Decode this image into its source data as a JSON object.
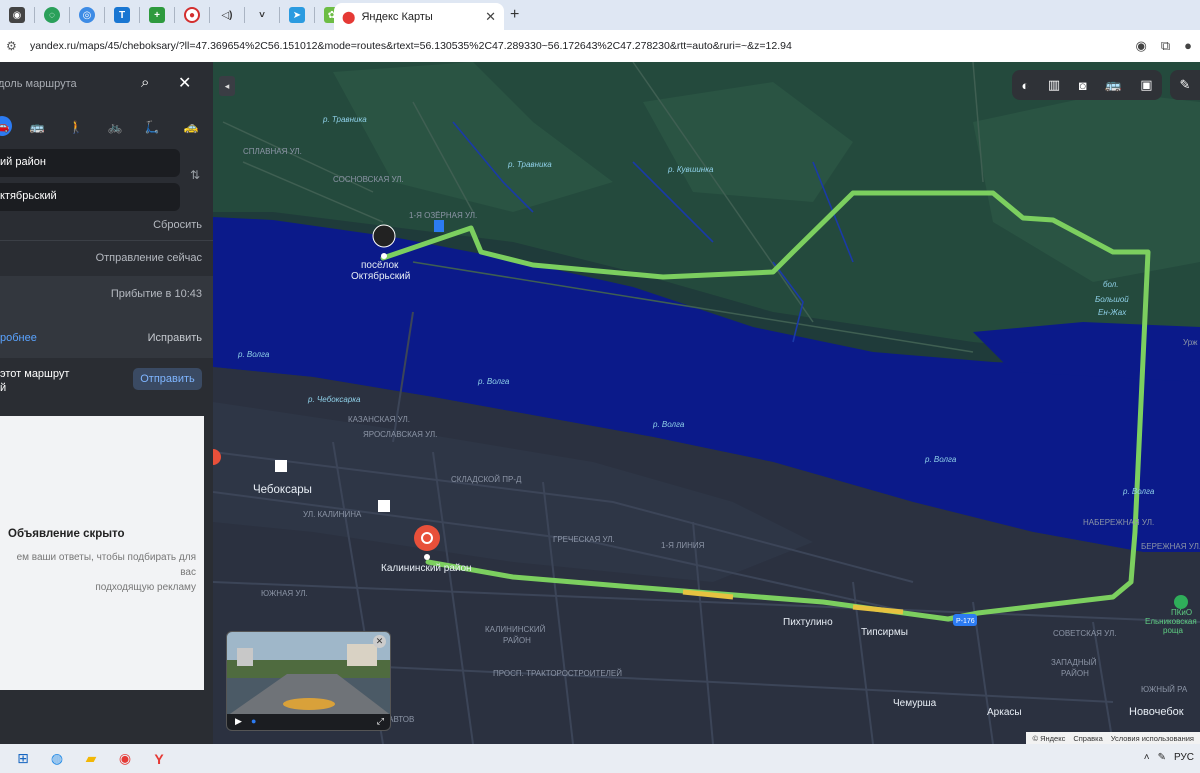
{
  "browser": {
    "tab_title": "Яндекс Карты",
    "url": "yandex.ru/maps/45/cheboksary/?ll=47.369654%2C56.151012&mode=routes&rtext=56.130535%2C47.289330~56.172643%2C47.278230&rtt=auto&ruri=~&z=12.94",
    "new_tab": "+",
    "close_tab": "✕"
  },
  "panel": {
    "search_placeholder": "доль маршрута",
    "from": "ий район",
    "to": "ктябрьский",
    "reset": "Сбросить",
    "departure": "Отправление сейчас",
    "arrival": "Прибытие в 10:43",
    "details": "робнее",
    "fix": "Исправить",
    "share_line1": "этот маршрут",
    "share_line2": "й",
    "send": "Отправить",
    "ad_title": "Объявление скрыто",
    "ad_sub1": "ем ваши ответы, чтобы подбирать для вас",
    "ad_sub2": "подходящую рекламу"
  },
  "map": {
    "labels": {
      "poselok1": "посёлок",
      "poselok2": "Октябрьский",
      "cheboksary": "Чебоксары",
      "kalininsky": "Калининский район",
      "volga1": "р. Волга",
      "volga2": "р. Волга",
      "volga3": "р. Волга",
      "volga4": "р. Волга",
      "volga5": "р. Волга",
      "travnika1": "р. Травника",
      "travnika2": "р. Травника",
      "cheboksarka": "р. Чебоксарка",
      "kuvshinka": "р. Кувшинка",
      "bol1": "бол.",
      "bol2": "Большой",
      "bol3": "Ен-Жах",
      "pikhtulino": "Пихтулино",
      "tipsirmy": "Типсирмы",
      "chemursha": "Чемурша",
      "arkasy": "Аркасы",
      "novocheb": "Новочебок",
      "kal_district1": "КАЛИНИНСКИЙ",
      "kal_district2": "РАЙОН",
      "zapadny1": "ЗАПАДНЫЙ",
      "zapadny2": "РАЙОН",
      "yuzhny": "ЮЖНЫЙ РА",
      "park1": "ПКиО",
      "park2": "Ельниковская",
      "park3": "роща",
      "urzh": "Урж",
      "r176": "Р-176",
      "street_sovetskaya": "СОВЕТСКАЯ УЛ.",
      "street_kazanskaya": "КАЗАНСКАЯ УЛ.",
      "street_yaroslavskaya": "ЯРОСЛАВСКАЯ УЛ.",
      "street_1ya_liniya": "1-Я ЛИНИЯ",
      "street_ozernaya": "1-Я ОЗЁРНАЯ УЛ.",
      "street_splavnaya": "СПЛАВНАЯ УЛ.",
      "street_sosnovskaya": "СОСНОВСКАЯ УЛ.",
      "street_naberezhnaya": "НАБЕРЕЖНАЯ УЛ.",
      "street_traktor": "ПРОСП. ТРАКТОРОСТРОИТЕЛЕЙ",
      "street_kalinina": "УЛ. КАЛИНИНА",
      "street_yuzhnaya": "ЮЖНАЯ УЛ.",
      "street_berezhnaya": "БЕРЕЖНАЯ УЛ.",
      "street_grecheskaya": "ГРЕЧЕСКАЯ УЛ.",
      "street_skladskaya": "СКЛАДСКОЙ ПР-Д",
      "street_kosmonavt": "КОСМОНАВТОВ"
    },
    "copyright": [
      "© Яндекс",
      "Справка",
      "Условия использования"
    ],
    "route_color": "#7ccf5f",
    "water_color": "#0b1a8a"
  },
  "taskbar": {
    "lang": "РУС"
  }
}
